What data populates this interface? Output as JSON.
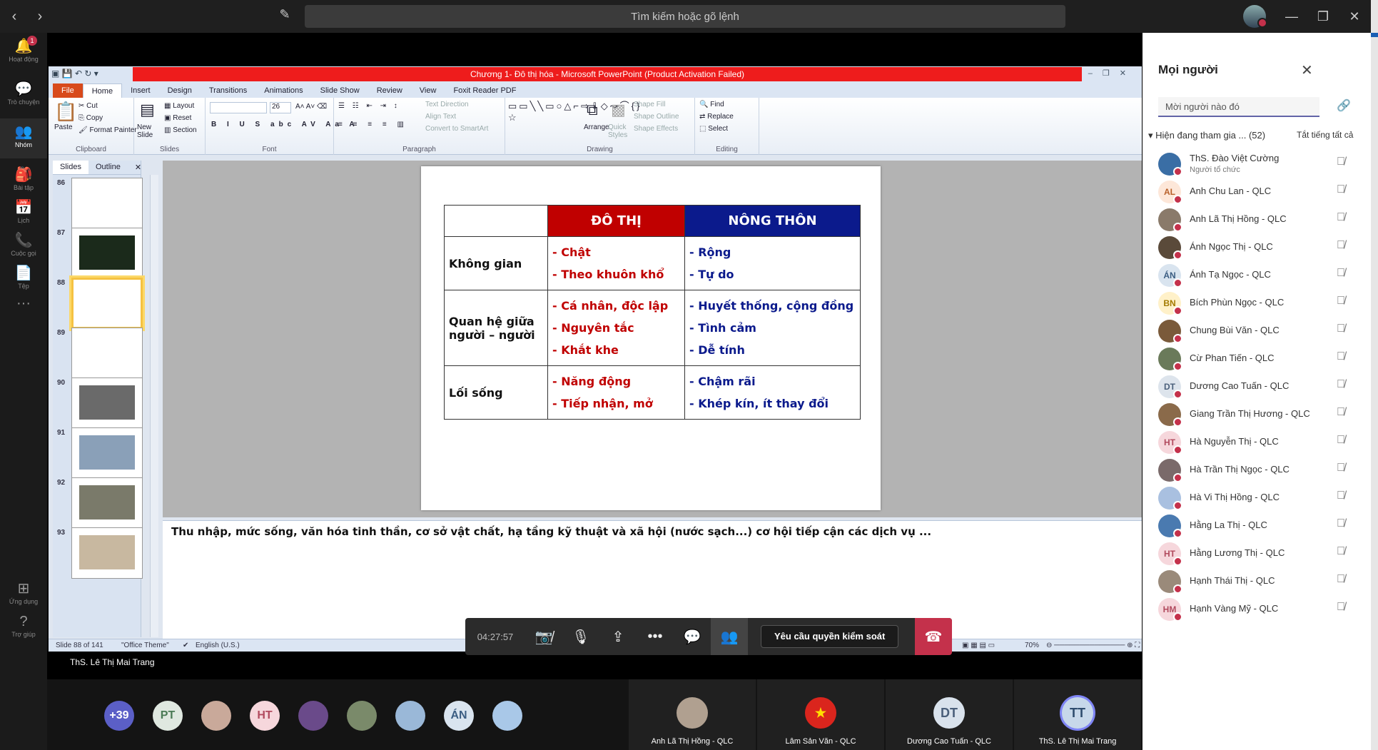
{
  "titlebar": {
    "search_placeholder": "Tìm kiếm hoặc gõ lệnh"
  },
  "rail": [
    {
      "label": "Hoạt động",
      "icon": "bell-icon",
      "glyph": "🔔",
      "badge": "1"
    },
    {
      "label": "Trò chuyện",
      "icon": "chat-icon",
      "glyph": "💬"
    },
    {
      "label": "Nhóm",
      "icon": "teams-icon",
      "glyph": "👥",
      "active": true
    },
    {
      "label": "Bài tập",
      "icon": "assignments-icon",
      "glyph": "🎒"
    },
    {
      "label": "Lịch",
      "icon": "calendar-icon",
      "glyph": "📅"
    },
    {
      "label": "Cuộc gọi",
      "icon": "phone-icon",
      "glyph": "📞"
    },
    {
      "label": "Tệp",
      "icon": "file-icon",
      "glyph": "📄"
    },
    {
      "label": "",
      "icon": "more-icon",
      "glyph": "···"
    },
    {
      "label": "Ứng dụng",
      "icon": "apps-icon",
      "glyph": "⊞"
    },
    {
      "label": "Trợ giúp",
      "icon": "help-icon",
      "glyph": "?"
    }
  ],
  "ppt": {
    "window_title": "Chương 1- Đô thị hóa - Microsoft PowerPoint (Product Activation Failed)",
    "tabs": [
      "File",
      "Home",
      "Insert",
      "Design",
      "Transitions",
      "Animations",
      "Slide Show",
      "Review",
      "View",
      "Foxit Reader PDF"
    ],
    "ribbon": {
      "paste": "Paste",
      "cut": "Cut",
      "copy": "Copy",
      "format_painter": "Format Painter",
      "clipboard": "Clipboard",
      "new_slide": "New Slide",
      "layout": "Layout",
      "reset": "Reset",
      "section": "Section",
      "slides": "Slides",
      "font_size": "26",
      "font": "Font",
      "text_direction": "Text Direction",
      "align_text": "Align Text",
      "convert_smartart": "Convert to SmartArt",
      "paragraph": "Paragraph",
      "arrange": "Arrange",
      "quick_styles": "Quick Styles",
      "shape_fill": "Shape Fill",
      "shape_outline": "Shape Outline",
      "shape_effects": "Shape Effects",
      "drawing": "Drawing",
      "find": "Find",
      "replace": "Replace",
      "select": "Select",
      "editing": "Editing"
    },
    "panel_tabs": [
      "Slides",
      "Outline"
    ],
    "thumb_numbers": [
      "86",
      "87",
      "88",
      "89",
      "90",
      "91",
      "92",
      "93"
    ],
    "slide": {
      "header_urban": "ĐÔ THỊ",
      "header_rural": "NÔNG THÔN",
      "rows": [
        {
          "label": "Không gian",
          "urban": [
            "- Chật",
            "- Theo khuôn khổ"
          ],
          "rural": [
            "- Rộng",
            "- Tự do"
          ]
        },
        {
          "label": "Quan hệ giữa người – người",
          "urban": [
            "- Cá nhân, độc lập",
            "- Nguyên tắc",
            "- Khắt khe"
          ],
          "rural": [
            "- Huyết thống, cộng đồng",
            "- Tình cảm",
            "- Dễ tính"
          ]
        },
        {
          "label": "Lối sống",
          "urban": [
            "- Năng động",
            "- Tiếp nhận, mở"
          ],
          "rural": [
            "- Chậm rãi",
            "- Khép kín, ít thay đổi"
          ]
        }
      ]
    },
    "notes": "Thu nhập, mức sống, văn hóa tinh thần, cơ sở vật chất, hạ tầng kỹ thuật và xã hội (nước sạch...) cơ hội tiếp cận các dịch vụ ...",
    "status": {
      "slide": "Slide 88 of 141",
      "theme": "\"Office Theme\"",
      "language": "English (U.S.)",
      "zoom": "70%"
    }
  },
  "call": {
    "timer": "04:27:57",
    "request_control": "Yêu cầu quyền kiểm soát",
    "presenter": "ThS. Lê Thị Mai Trang"
  },
  "gallery": {
    "overflow": "+39",
    "bubbles": [
      {
        "initials": "PT",
        "bg": "#dfe8e0",
        "fg": "#4a7a55"
      },
      {
        "initials": "",
        "bg": "#c9a99a"
      },
      {
        "initials": "HT",
        "bg": "#f6d7dc",
        "fg": "#b14a5e"
      },
      {
        "initials": "",
        "bg": "#6a4a8a"
      },
      {
        "initials": "",
        "bg": "#7a8a6a"
      },
      {
        "initials": "",
        "bg": "#9ab8d8"
      },
      {
        "initials": "ÁN",
        "bg": "#d9e4ef",
        "fg": "#3b5d82"
      },
      {
        "initials": "",
        "bg": "#a9c8e8"
      }
    ],
    "tiles": [
      {
        "name": "Anh Lã Thị Hồng - QLC",
        "initials": "",
        "bg": "#b0a090"
      },
      {
        "name": "Lâm Sản Văn - QLC",
        "initials": "★",
        "bg": "#da251d",
        "fg": "#ffde00"
      },
      {
        "name": "Dương Cao Tuấn - QLC",
        "initials": "DT",
        "bg": "#d9e2ec",
        "fg": "#4a5f7a"
      },
      {
        "name": "ThS. Lê Thị Mai Trang",
        "initials": "TT",
        "bg": "#c7d8ea",
        "fg": "#2f4c6e"
      }
    ]
  },
  "people": {
    "title": "Mọi người",
    "invite_placeholder": "Mời người nào đó",
    "section": "Hiện đang tham gia ... (52)",
    "mute_all": "Tắt tiếng tất cả",
    "list": [
      {
        "name": "ThS. Đào Việt Cường",
        "role": "Người tổ chức",
        "initials": "",
        "bg": "#3a6ea5"
      },
      {
        "name": "Anh Chu Lan - QLC",
        "initials": "AL",
        "bg": "#fde7d9",
        "fg": "#b8612b"
      },
      {
        "name": "Anh Lã Thị Hồng - QLC",
        "initials": "",
        "bg": "#8a7a6a"
      },
      {
        "name": "Ánh Ngọc Thị - QLC",
        "initials": "",
        "bg": "#5a4a3a"
      },
      {
        "name": "Ánh Tạ Ngọc - QLC",
        "initials": "ÁN",
        "bg": "#d9e4ef",
        "fg": "#3b5d82"
      },
      {
        "name": "Bích Phùn Ngọc - QLC",
        "initials": "BN",
        "bg": "#fff1c9",
        "fg": "#a37a00"
      },
      {
        "name": "Chung Bùi Văn - QLC",
        "initials": "",
        "bg": "#7a5a3a"
      },
      {
        "name": "Cừ Phan Tiến - QLC",
        "initials": "",
        "bg": "#6a7a5a"
      },
      {
        "name": "Dương Cao Tuấn - QLC",
        "initials": "DT",
        "bg": "#dde4ec",
        "fg": "#4a5f7a"
      },
      {
        "name": "Giang Trần Thị Hương - QLC",
        "initials": "",
        "bg": "#8a6a4a"
      },
      {
        "name": "Hà Nguyễn Thị - QLC",
        "initials": "HT",
        "bg": "#f6d7dc",
        "fg": "#b14a5e"
      },
      {
        "name": "Hà Trần Thị Ngọc - QLC",
        "initials": "",
        "bg": "#7a6a6a"
      },
      {
        "name": "Hà Vi Thị Hồng - QLC",
        "initials": "",
        "bg": "#a9c0e0"
      },
      {
        "name": "Hằng La Thị - QLC",
        "initials": "",
        "bg": "#4a7ab0"
      },
      {
        "name": "Hằng Lương Thị - QLC",
        "initials": "HT",
        "bg": "#f6d7dc",
        "fg": "#b14a5e"
      },
      {
        "name": "Hạnh Thái Thị - QLC",
        "initials": "",
        "bg": "#9a8a7a"
      },
      {
        "name": "Hạnh Vàng Mỹ - QLC",
        "initials": "HM",
        "bg": "#f6d7dc",
        "fg": "#b14a5e"
      }
    ]
  }
}
